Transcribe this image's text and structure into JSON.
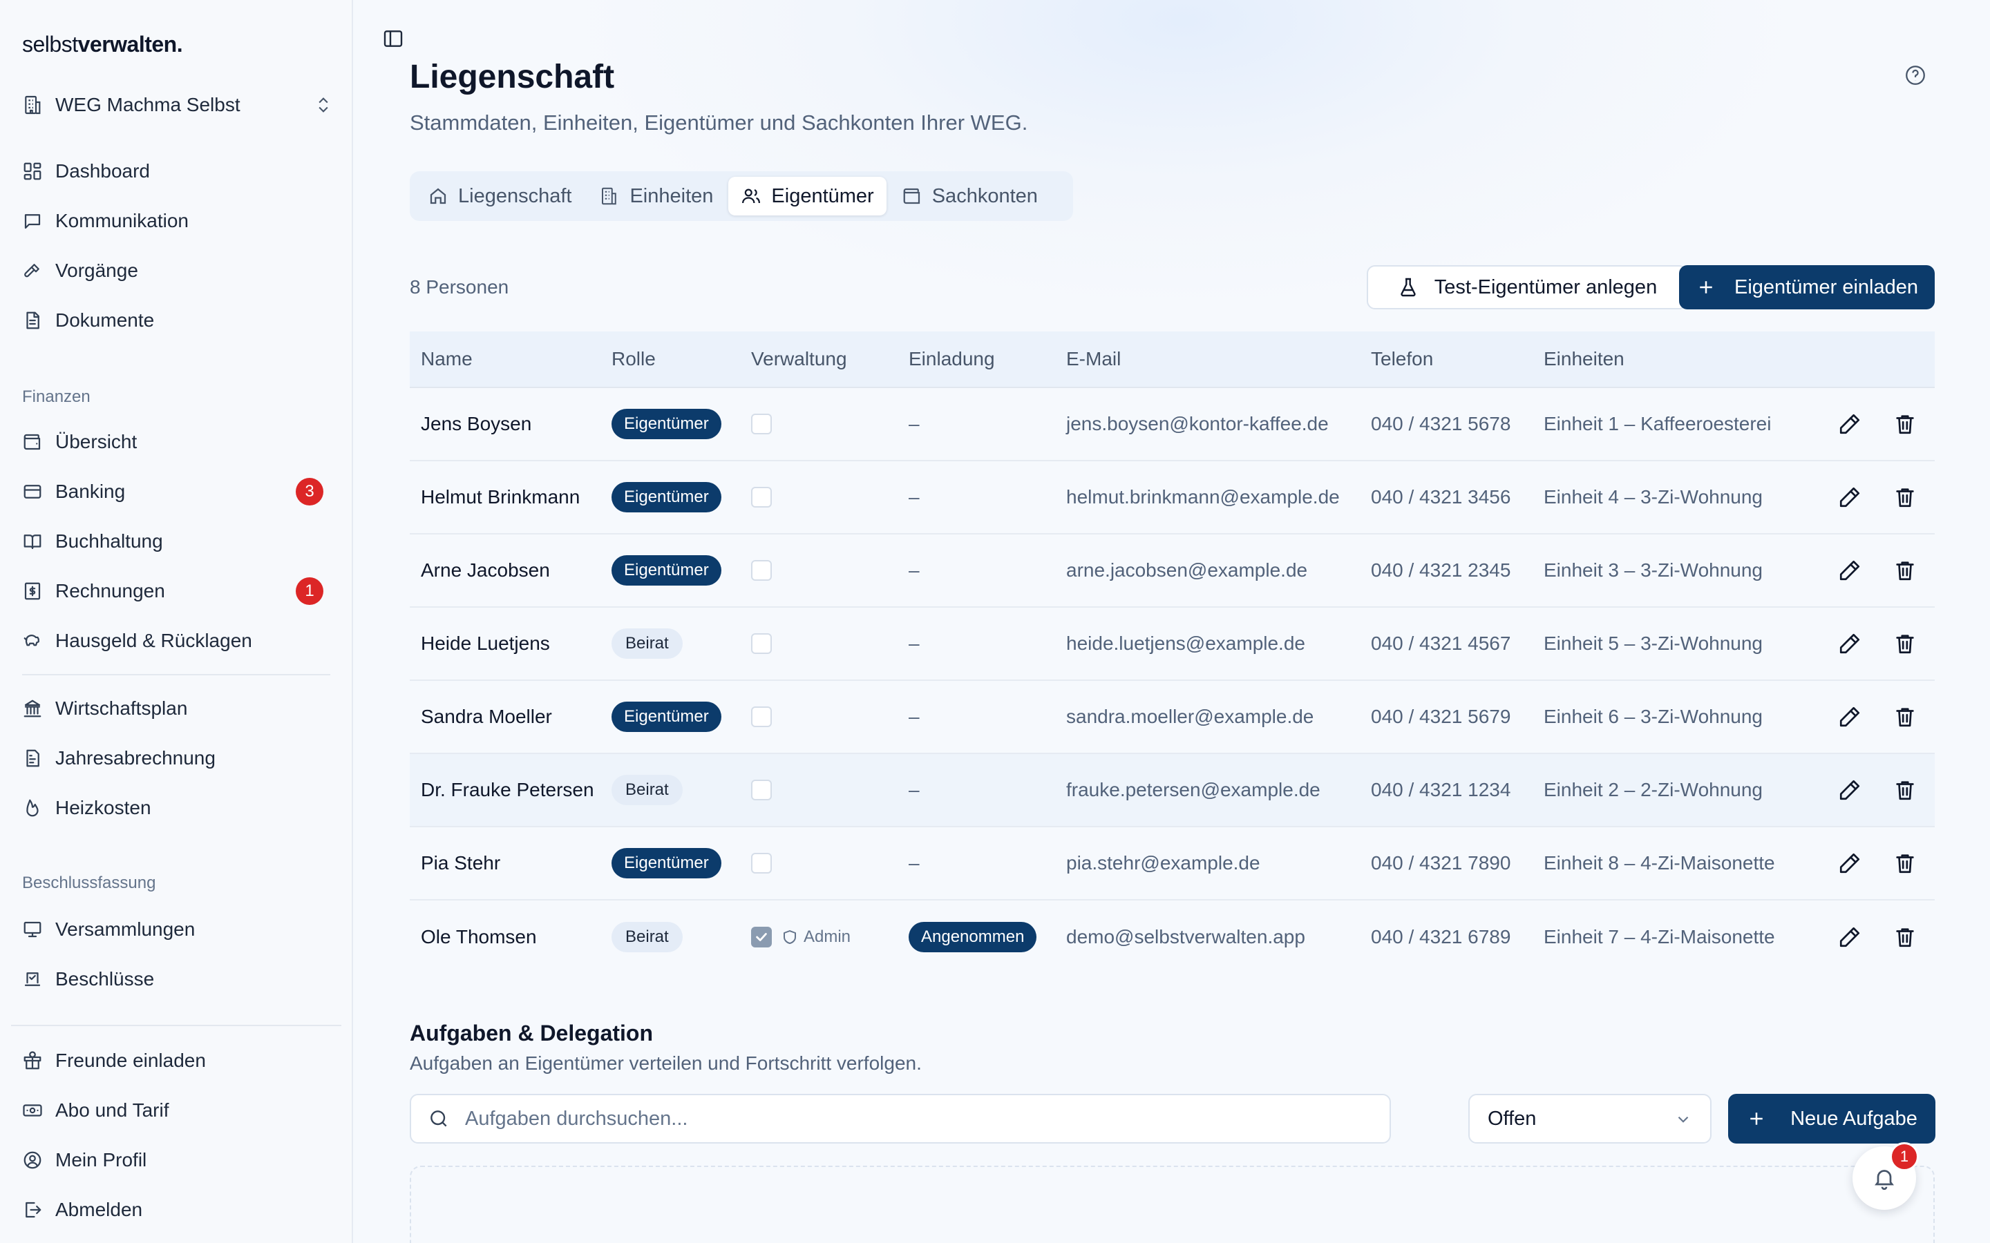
{
  "brand": {
    "logo_light": "selbst",
    "logo_bold": "verwalten."
  },
  "org": {
    "name": "WEG Machma Selbst",
    "icon": "building-icon"
  },
  "sidebar": {
    "main_items": [
      {
        "label": "Dashboard",
        "icon": "dashboard-icon"
      },
      {
        "label": "Kommunikation",
        "icon": "message-icon"
      },
      {
        "label": "Vorgänge",
        "icon": "hammer-icon"
      },
      {
        "label": "Dokumente",
        "icon": "document-icon"
      }
    ],
    "finance_section": "Finanzen",
    "finance_items": [
      {
        "label": "Übersicht",
        "icon": "wallet-icon"
      },
      {
        "label": "Banking",
        "icon": "card-icon",
        "badge": "3"
      },
      {
        "label": "Buchhaltung",
        "icon": "book-icon"
      },
      {
        "label": "Rechnungen",
        "icon": "invoice-icon",
        "badge": "1"
      },
      {
        "label": "Hausgeld & Rücklagen",
        "icon": "piggy-bank-icon"
      },
      {
        "label": "Wirtschaftsplan",
        "icon": "landmark-icon"
      },
      {
        "label": "Jahresabrechnung",
        "icon": "report-icon"
      },
      {
        "label": "Heizkosten",
        "icon": "flame-icon"
      }
    ],
    "resolution_section": "Beschlussfassung",
    "resolution_items": [
      {
        "label": "Versammlungen",
        "icon": "presentation-icon"
      },
      {
        "label": "Beschlüsse",
        "icon": "vote-icon"
      }
    ],
    "account_items": [
      {
        "label": "Freunde einladen",
        "icon": "gift-icon"
      },
      {
        "label": "Abo und Tarif",
        "icon": "banknote-icon"
      },
      {
        "label": "Mein Profil",
        "icon": "user-circle-icon"
      },
      {
        "label": "Abmelden",
        "icon": "logout-icon"
      }
    ]
  },
  "header": {
    "title": "Liegenschaft",
    "subtitle": "Stammdaten, Einheiten, Eigentümer und Sachkonten Ihrer WEG."
  },
  "tabs": [
    {
      "label": "Liegenschaft",
      "icon": "home-icon",
      "active": false
    },
    {
      "label": "Einheiten",
      "icon": "building-icon",
      "active": false
    },
    {
      "label": "Eigentümer",
      "icon": "users-icon",
      "active": true
    },
    {
      "label": "Sachkonten",
      "icon": "wallet-icon",
      "active": false
    }
  ],
  "owners": {
    "count_label": "8 Personen",
    "test_button": "Test-Eigentümer anlegen",
    "invite_button": "Eigentümer einladen",
    "columns": [
      "Name",
      "Rolle",
      "Verwaltung",
      "Einladung",
      "E-Mail",
      "Telefon",
      "Einheiten"
    ],
    "rows": [
      {
        "name": "Jens Boysen",
        "role": "Eigentümer",
        "role_style": "dark",
        "admin": false,
        "invite": "–",
        "email": "jens.boysen@kontor-kaffee.de",
        "phone": "040 / 4321 5678",
        "unit": "Einheit 1 – Kaffeeroesterei"
      },
      {
        "name": "Helmut Brinkmann",
        "role": "Eigentümer",
        "role_style": "dark",
        "admin": false,
        "invite": "–",
        "email": "helmut.brinkmann@example.de",
        "phone": "040 / 4321 3456",
        "unit": "Einheit 4 – 3-Zi-Wohnung"
      },
      {
        "name": "Arne Jacobsen",
        "role": "Eigentümer",
        "role_style": "dark",
        "admin": false,
        "invite": "–",
        "email": "arne.jacobsen@example.de",
        "phone": "040 / 4321 2345",
        "unit": "Einheit 3 – 3-Zi-Wohnung"
      },
      {
        "name": "Heide Luetjens",
        "role": "Beirat",
        "role_style": "light",
        "admin": false,
        "invite": "–",
        "email": "heide.luetjens@example.de",
        "phone": "040 / 4321 4567",
        "unit": "Einheit 5 – 3-Zi-Wohnung"
      },
      {
        "name": "Sandra Moeller",
        "role": "Eigentümer",
        "role_style": "dark",
        "admin": false,
        "invite": "–",
        "email": "sandra.moeller@example.de",
        "phone": "040 / 4321 5679",
        "unit": "Einheit 6 – 3-Zi-Wohnung"
      },
      {
        "name": "Dr. Frauke Petersen",
        "role": "Beirat",
        "role_style": "light",
        "admin": false,
        "invite": "–",
        "email": "frauke.petersen@example.de",
        "phone": "040 / 4321 1234",
        "unit": "Einheit 2 – 2-Zi-Wohnung"
      },
      {
        "name": "Pia Stehr",
        "role": "Eigentümer",
        "role_style": "dark",
        "admin": false,
        "invite": "–",
        "email": "pia.stehr@example.de",
        "phone": "040 / 4321 7890",
        "unit": "Einheit 8 – 4-Zi-Maisonette"
      },
      {
        "name": "Ole Thomsen",
        "role": "Beirat",
        "role_style": "light",
        "admin": true,
        "admin_label": "Admin",
        "invite": "Angenommen",
        "email": "demo@selbstverwalten.app",
        "phone": "040 / 4321 6789",
        "unit": "Einheit 7 – 4-Zi-Maisonette"
      }
    ]
  },
  "tasks": {
    "title": "Aufgaben & Delegation",
    "subtitle": "Aufgaben an Eigentümer verteilen und Fortschritt verfolgen.",
    "search_placeholder": "Aufgaben durchsuchen...",
    "filter_value": "Offen",
    "new_button": "Neue Aufgabe"
  },
  "notifications": {
    "count": "1"
  },
  "colors": {
    "primary": "#0c3b6b",
    "badge": "#dc2626",
    "highlight_row": "#eef4fb"
  }
}
